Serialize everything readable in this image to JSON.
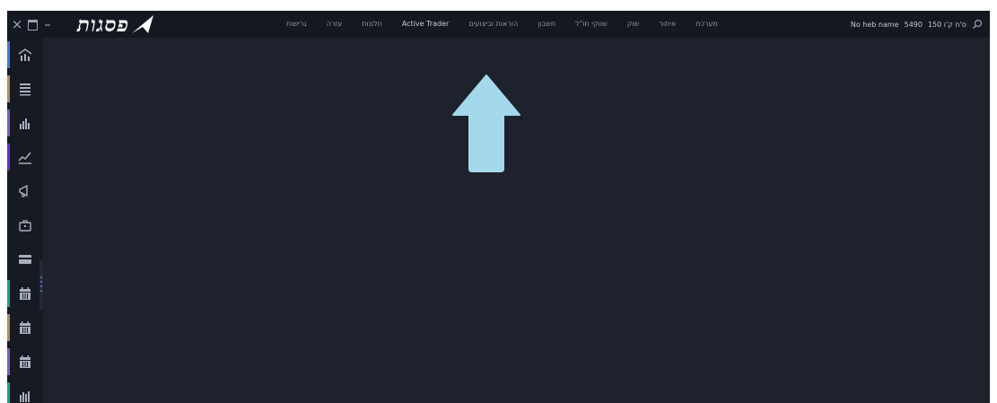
{
  "window": {
    "close_glyph": "×",
    "minimize_glyph": "–"
  },
  "logo": {
    "text": "פסגות",
    "mark_icon": "arrow-logo-icon"
  },
  "menu": {
    "items": [
      {
        "label": "גרישות"
      },
      {
        "label": "עזרה"
      },
      {
        "label": "חלונות"
      },
      {
        "label": "Active Trader",
        "active": true
      },
      {
        "label": "הוראות וביצועים"
      },
      {
        "label": "חשבון"
      },
      {
        "label": "שווקי חו\"ל"
      },
      {
        "label": "שוק"
      },
      {
        "label": "איתור"
      },
      {
        "label": "מערכת"
      }
    ]
  },
  "account": {
    "name": "No heb name",
    "number": "5490",
    "branch": "150 ס'ח ק'ו"
  },
  "sidebar": {
    "items": [
      {
        "icon": "home-chart-icon",
        "accent": "#3e7bd6"
      },
      {
        "icon": "list-icon",
        "accent": "#b08d5b"
      },
      {
        "icon": "bar-chart-icon",
        "accent": "#7a5fc0"
      },
      {
        "icon": "line-chart-icon",
        "accent": "#6a2fd0"
      },
      {
        "icon": "megaphone-icon",
        "accent": ""
      },
      {
        "icon": "briefcase-icon",
        "accent": ""
      },
      {
        "icon": "card-icon",
        "accent": ""
      },
      {
        "icon": "calendar-icon",
        "accent": "#2a9d8f"
      },
      {
        "icon": "calendar-icon",
        "accent": "#b08d5b"
      },
      {
        "icon": "calendar-icon",
        "accent": "#7a5fc0"
      },
      {
        "icon": "chart-icon",
        "accent": "#2a9d8f"
      }
    ]
  },
  "colors": {
    "topbar": "#141821",
    "workspace": "#1d222c",
    "sidebar": "#161a22",
    "pointer_arrow": "#a3d9ea"
  }
}
